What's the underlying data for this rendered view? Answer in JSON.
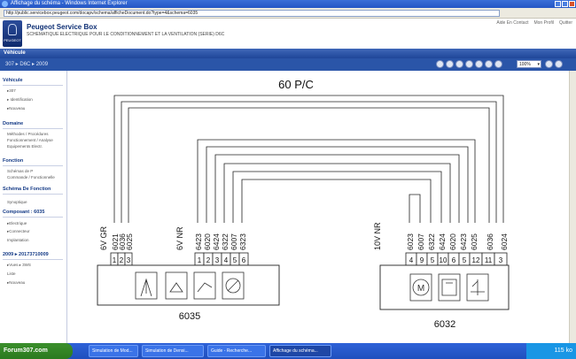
{
  "window": {
    "title": "Affichage du schéma - Windows Internet Explorer"
  },
  "browser": {
    "url": "http://public.servicebox.peugeot.com/docapv/schema/afficheDocument.do?type=4&schema=6035"
  },
  "header": {
    "app_title": "Peugeot Service Box",
    "subtitle": "SCHEMATIQUE ELECTRIQUE POUR LE CONDITIONNEMENT ET LA VENTILATION (SERIE) D6C",
    "logo_text": "PEUGEOT",
    "links": [
      "Aide En Contact",
      "Mon Profil",
      "Quitter"
    ]
  },
  "vehicle_bar": {
    "label": "Véhicule"
  },
  "model_bar": {
    "model": "307 ▸ D6C ▸ 2009"
  },
  "toolbar": {
    "zoom_value": "100%"
  },
  "sidebar": {
    "sections": [
      {
        "title": "Véhicule",
        "items": [
          "▸307",
          "▸ Identification",
          "▸Nouveau"
        ]
      },
      {
        "title": "Domaine",
        "items": [
          "Méthodes / Procédures",
          "Fonctionnement / Analyse",
          "Equipements Electr."
        ]
      },
      {
        "title": "Fonction",
        "items": [
          "Schémas de P",
          "Commande / Fonctionnelle"
        ]
      },
      {
        "title": "Schéma De Fonction",
        "items": [
          "Synoptique"
        ]
      },
      {
        "title": "Composant : 6035",
        "items": [
          "▸Electrique",
          "▸Connecteur",
          "Implantation"
        ]
      },
      {
        "title": "2009 ▸ 20173710009",
        "items": [
          "▸Vues ▸ 3WS",
          "Liste",
          "▸Nouveau"
        ]
      }
    ]
  },
  "diagram": {
    "bus_label": "60 P/C",
    "left_connector": {
      "component": "6035",
      "groups": [
        {
          "name": "6V GR",
          "wires": [
            "6021",
            "6036",
            "6025"
          ],
          "pins": [
            "1",
            "2",
            "3"
          ]
        },
        {
          "name": "6V NR",
          "wires": [
            "6423",
            "6020",
            "6424",
            "6322",
            "6007",
            "6323"
          ],
          "pins": [
            "1",
            "2",
            "3",
            "4",
            "5",
            "6"
          ]
        }
      ]
    },
    "right_connector": {
      "component": "6032",
      "groups": [
        {
          "name": "10V NR",
          "wires": [
            "6023",
            "6007",
            "6322",
            "6424",
            "6020",
            "6423",
            "6025",
            "6036",
            "6024"
          ],
          "pins": [
            "4",
            "9",
            "5",
            "10",
            "6",
            "5",
            "12",
            "11",
            "3"
          ]
        }
      ]
    }
  },
  "taskbar": {
    "start_label": "Forum307.com",
    "tasks": [
      "Simulation de Mod...",
      "Simulation de Densi...",
      "Guide - Recherche...",
      "Affichage du schéma..."
    ],
    "clock": "115 ko"
  }
}
